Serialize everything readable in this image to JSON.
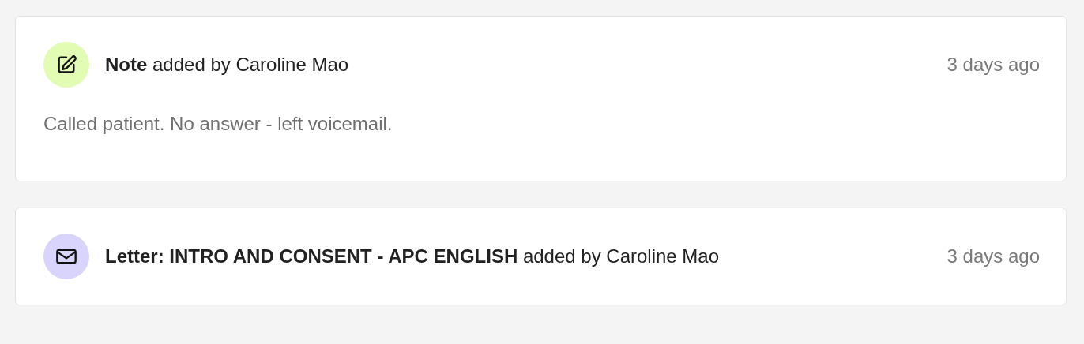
{
  "activities": [
    {
      "kind": "note",
      "heading": "**Note** added by Caroline Mao",
      "time": "3 days ago",
      "body": "Called patient. No answer - left voicemail."
    },
    {
      "kind": "letter",
      "heading": "**Letter: INTRO AND CONSENT - APC ENGLISH** added by Caroline Mao",
      "time": "3 days ago"
    }
  ]
}
